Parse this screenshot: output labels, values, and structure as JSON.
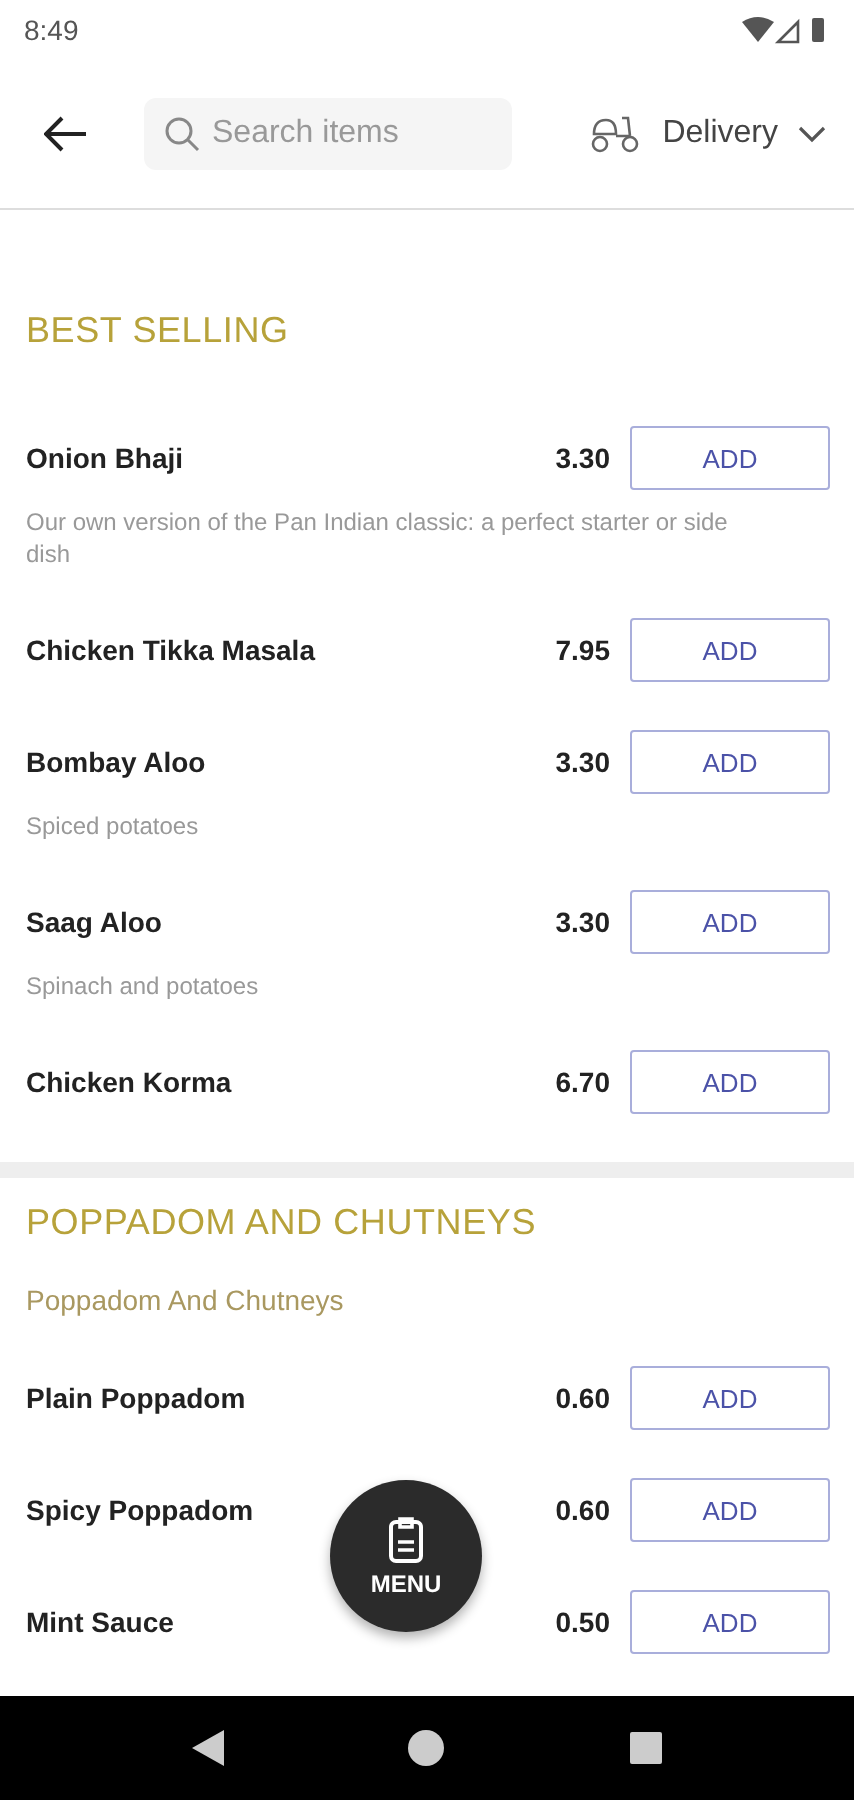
{
  "status_bar": {
    "time": "8:49"
  },
  "header": {
    "search": {
      "placeholder": "Search items"
    },
    "mode": "Delivery"
  },
  "sections": [
    {
      "title": "BEST SELLING",
      "items": [
        {
          "name": "Onion Bhaji",
          "price": "3.30",
          "description": "Our own version of the Pan Indian classic: a perfect starter or side dish",
          "button": "ADD"
        },
        {
          "name": "Chicken Tikka Masala",
          "price": "7.95",
          "button": "ADD"
        },
        {
          "name": "Bombay Aloo",
          "price": "3.30",
          "description": "Spiced potatoes",
          "button": "ADD"
        },
        {
          "name": "Saag Aloo",
          "price": "3.30",
          "description": "Spinach and potatoes",
          "button": "ADD"
        },
        {
          "name": "Chicken Korma",
          "price": "6.70",
          "button": "ADD"
        }
      ]
    },
    {
      "title": "POPPADOM AND CHUTNEYS",
      "subtitle": "Poppadom And Chutneys",
      "items": [
        {
          "name": "Plain Poppadom",
          "price": "0.60",
          "button": "ADD"
        },
        {
          "name": "Spicy Poppadom",
          "price": "0.60",
          "button": "ADD"
        },
        {
          "name": "Mint Sauce",
          "price": "0.50",
          "button": "ADD"
        }
      ]
    }
  ],
  "fab": {
    "label": "MENU"
  }
}
